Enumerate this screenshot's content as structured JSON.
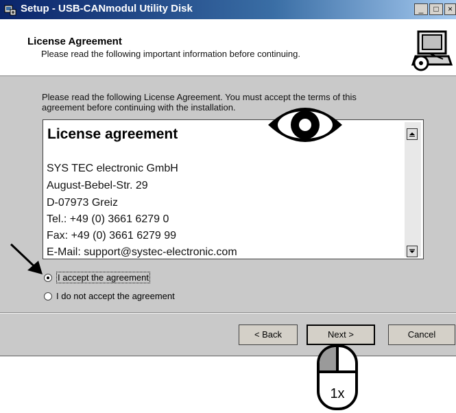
{
  "window": {
    "title": "Setup - USB-CANmodul Utility Disk",
    "controls": {
      "minimize": "_",
      "maximize": "□",
      "close": "×"
    }
  },
  "header": {
    "title": "License Agreement",
    "subtitle": "Please read the following important information before continuing."
  },
  "intro_line1": "Please read the following License Agreement. You must accept the terms of this",
  "intro_line2": "agreement before continuing with the installation.",
  "license": {
    "heading": "License agreement",
    "lines": [
      "SYS TEC electronic GmbH",
      "August-Bebel-Str. 29",
      "D-07973 Greiz",
      "Tel.:  +49 (0) 3661 6279 0",
      "Fax:  +49 (0) 3661 6279 99",
      "E-Mail:  support@systec-electronic.com"
    ]
  },
  "options": {
    "accept": {
      "label": "I accept the agreement",
      "selected": true
    },
    "decline": {
      "label": "I do not accept the agreement",
      "selected": false
    }
  },
  "buttons": {
    "back": "< Back",
    "next": "Next >",
    "cancel": "Cancel"
  },
  "annotation": {
    "click_count": "1x"
  },
  "icons": [
    "setup-app-icon",
    "installer-computer-logo",
    "eye-icon",
    "pointer-arrow-icon",
    "mouse-left-click-icon",
    "scroll-up-icon",
    "scroll-down-icon"
  ]
}
